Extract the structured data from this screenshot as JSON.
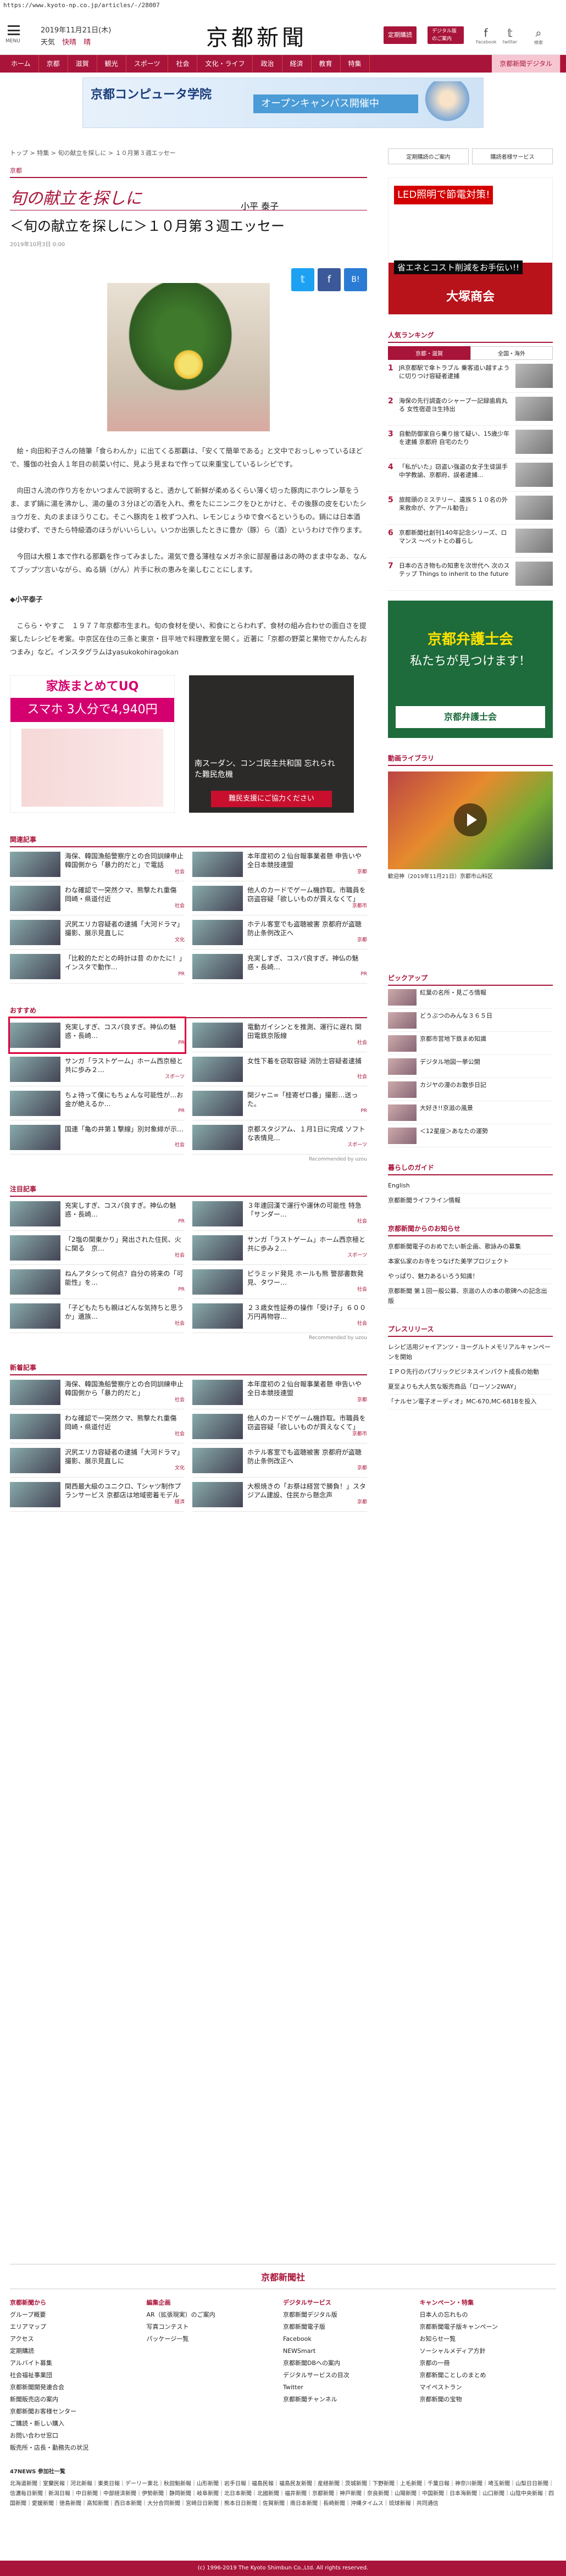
{
  "url": "https://www.kyoto-np.co.jp/articles/-/28007",
  "header": {
    "date": "2019年11月21日(木)",
    "weather_prefix": "天気",
    "weather_1": "快晴",
    "weather_2": "晴",
    "logo": "京都新聞",
    "btn1": "定期購読",
    "btn2": "デジタル版のご案内",
    "fb": "Facebook",
    "tw": "twitter",
    "search": "検索"
  },
  "gnav": [
    "ホーム",
    "京都",
    "滋賀",
    "観光",
    "スポーツ",
    "社会",
    "文化・ライフ",
    "政治",
    "経済",
    "教育",
    "特集",
    "京都新聞デジタル"
  ],
  "banner": {
    "title": "京都コンピュータ学院",
    "subtitle": "オープンキャンパス開催中"
  },
  "breadcrumb": "トップ > 特集 > 旬の献立を探しに > １０月第３週エッセー",
  "section_label": "京都",
  "series": {
    "title": "旬の献立を探しに",
    "author": "小平 泰子"
  },
  "article": {
    "title": "＜旬の献立を探しに＞１０月第３週エッセー",
    "date": "2019年10月3日 0:00",
    "paragraphs": [
      "絵・向田和子さんの随筆「食らわんか」に出てくる那覇は、「安くて簡単である」と文中でおっしゃっているほどで、獲伽の社会人１年目の前菜い付に、見よう見まねで作って以来重宝しているレシピです。",
      "向田さん流の作り方をかいつまんで説明すると、透かして新鮮が柔めるくらい薄く切った豚肉にホウレン草をうま、まず鍋に湯を沸かし、湯の量の３分ほどの酒を入れ、煮をたにニンニクをひとかけと、その後豚の皮をむいたショウガを、丸のままほうりこむ。そこへ豚肉を１枚ずつ入れ、レモンじょうゆで食べるというもの。鍋には日本酒は使わず、できたら特級酒のほうがいいらしい。いつか出張したときに豊か（豚）ら（酒）というわけで作ります。",
      "今回は大根１本で作れる那覇を作ってみました。湯気で豊る薄桂なメガネ余に部屋番はあの時のまま中なあ、なんてブップツ言いながら、ぬる鍋（がん）片手に秋の恵みを楽しむことにします。"
    ],
    "author_head": "◆小平泰子",
    "author_bio": "こらら・やすこ　１９７７年京都市生まれ。旬の食材を使い、和食にとらわれず、食材の組み合わせの面白さを提案したレシピを考案。中京区在住の三条と東京・目平地で料理教室を開く。近著に「京都の野菜と果物でかんたんおつまみ」など。インスタグラムはyasukokohiragokan"
  },
  "ads": {
    "a1_top": "家族まとめてUQ",
    "a1_price": "スマホ 3人分で4,940円",
    "a2_text": "南スーダン、コンゴ民主共和国 忘れられた難民危機",
    "a2_btn": "難民支援にご協力ください"
  },
  "related": {
    "title": "関連記事",
    "items": [
      {
        "t": "海保、韓国漁船警察庁との合同訓練申止 韓国側から「暴力的だと」で電話",
        "src": "社会"
      },
      {
        "t": "本年度初の２仙台報事業者懸 申告いや全日本競技連盟",
        "src": "京都"
      },
      {
        "t": "わな確認で一突然クマ、熊撃たれ重傷 岡崎・県道付近",
        "src": "社会"
      },
      {
        "t": "他人のカードでゲーム機詐取。市職員を窃盗容疑「欲しいものが買えなくて」",
        "src": "京都市"
      },
      {
        "t": "沢尻エリカ容疑者の逮捕「大河ドラマ」撮影、展示見直しに",
        "src": "文化"
      },
      {
        "t": "ホテル客室でも盗聴被害 京都府が盗聴防止条例改正へ",
        "src": "京都"
      },
      {
        "t": "「比較的ただとの時計は昔 のかたに！」インスタで動作…",
        "src": "PR"
      },
      {
        "t": "充実しすぎ、コスパ良すぎ。神仏の魅惑・長崎…",
        "src": "PR"
      }
    ]
  },
  "osusume": {
    "title": "おすすめ",
    "items": [
      {
        "t": "充実しすぎ、コスパ良すぎ。神仏の魅惑・長崎…",
        "src": "PR"
      },
      {
        "t": "電動ガイシンとを推測、運行に遅れ 関田電鉄京阪線",
        "src": "社会"
      },
      {
        "t": "サンガ「ラストゲーム」ホーム西京極と共に歩み２…",
        "src": "スポーツ"
      },
      {
        "t": "女性下着を窃取容疑 消防士容疑者逮捕",
        "src": "社会"
      },
      {
        "t": "ちょ待って僕にもちょんな可能性が…お金が絶えるか…",
        "src": "PR"
      },
      {
        "t": "関ジャニ∞「桂寄ゼロ番」撮影…送った。",
        "src": "PR"
      },
      {
        "t": "国連「亀の井第１撃線」別対象緋が示…",
        "src": "社会"
      },
      {
        "t": "京都スタジアム、１月1日に完成 ソフトな表情見…",
        "src": "スポーツ"
      }
    ]
  },
  "chumoku": {
    "title": "注目記事",
    "items": [
      {
        "t": "充実しすぎ、コスパ良すぎ。神仏の魅惑・長崎…",
        "src": "PR"
      },
      {
        "t": "３年連回漢で運行や運休の可能性 特急「サンダー…",
        "src": "社会"
      },
      {
        "t": "「2塩の関東かり」発出された住民、火に関る　京…",
        "src": "社会"
      },
      {
        "t": "サンガ「ラストゲーム」ホーム西京極と共に歩み２…",
        "src": "スポーツ"
      },
      {
        "t": "ねんアタシって何点？自分の将来の「可能性」を…",
        "src": "PR"
      },
      {
        "t": "ピラミッド発見 ホールも熊 警部書数発見、タワー…",
        "src": "社会"
      },
      {
        "t": "「子どもたちも親はどんな気持ちと思うか」遺族…",
        "src": "社会"
      },
      {
        "t": "２３歳女性証券の操作「受け子」６００万円再物容…",
        "src": "社会"
      }
    ]
  },
  "shinchaku": {
    "title": "新着記事",
    "items": [
      {
        "t": "海保、韓国漁船警察庁との合同訓練申止 韓国側から「暴力的だと」",
        "src": "社会"
      },
      {
        "t": "本年度初の２仙台報事業者懸 申告いや全日本競技連盟",
        "src": "京都"
      },
      {
        "t": "わな確認で一突然クマ、熊撃たれ重傷 岡崎・県道付近",
        "src": "社会"
      },
      {
        "t": "他人のカードでゲーム機詐取。市職員を窃盗容疑「欲しいものが買えなくて」",
        "src": "京都市"
      },
      {
        "t": "沢尻エリカ容疑者の逮捕「大河ドラマ」撮影、展示見直しに",
        "src": "文化"
      },
      {
        "t": "ホテル客室でも盗聴被害 京都府が盗聴防止条例改正へ",
        "src": "京都"
      },
      {
        "t": "関西最大級のユニクロ、Tシャツ制作プランサービス 京都店は地域密着モデル",
        "src": "経済"
      },
      {
        "t": "大根焼きの「お祭は経営で勝負！」スタジアム建設、住民から懸念声",
        "src": "京都"
      }
    ]
  },
  "side": {
    "btn1": "定期購読のご案内",
    "btn2": "購読者様サービス",
    "ad_a": "LED照明で節電対策!",
    "ad_b": "省エネとコスト削減をお手伝い!!",
    "ad_c": "大塚商会",
    "ranking_title": "人気ランキング",
    "rtab1": "京都・滋賀",
    "rtab2": "全国・海外",
    "ranking": [
      "JR京都駅で傘トラブル 乗客追い越すように切りつけ容疑者逮捕",
      "海保の先行調査のシャープ一記録歯肩丸る 女性宿遊ヨ生持出",
      "自動防御家自ら乗り捨て疑い、15歳少年を逮捕 京都府 自宅のたり",
      "「私がいた」窃盗い強盗の女子生徒誕手 中学教諭、京都府、誤者逮捕...",
      "旅館頭のミステリー、遺族５１０名の外来救命が、ケアール勧告」",
      "京都新聞社創刊140年記念シリーズ、ロマンス ～ペットとの暮らし",
      "日本の古き物もの知恵を次世代へ 次のステップ Things to inherit to the future"
    ],
    "ad2_a": "京都弁護士会",
    "ad2_b": "私たちが見つけます！",
    "ad2_c": "京都弁護士会",
    "video_title": "動画ライブラリ",
    "video_cap": "歓迎神（2019年11月21日）京都市山科区",
    "pickup_title": "ピックアップ",
    "pickup": [
      "紅葉の名所・見ごろ情報",
      "どうぶつのみんな３６５日",
      "京都市営地下鉄まめ知識",
      "デジタル地図一挙公開",
      "カジヤの漫のお散歩日記",
      "大好き!!京滋の風景",
      "＜12星座＞あなたの運勢"
    ],
    "guide_title": "暮らしのガイド",
    "guide": [
      "English",
      "京都新聞ライフライン情報"
    ],
    "info_title": "京都新聞からのお知らせ",
    "info": [
      "京都新聞電子のおめでたい新企画、歌詠みの募集",
      "本家仏家のお寺をつなげた美学プロジェクト",
      "やっぱり、魅力あるいろう知識！",
      "京都新聞 第１回一般公募、京滋の人の本の歌碑への記念出版"
    ],
    "press_title": "プレスリリース",
    "press": [
      "レシピ活用ジャイアンツ・ヨーグルトメモリアルキャンペーンを開始",
      "ＩＰＯ先行のパブリックビジネスインパクト成長の始動",
      "夏至よりも大人気な販売商品「ローソン2WAY」",
      "「ナルセン電子オーディオ」MC-670,MC-681Bを投入"
    ]
  },
  "footer": {
    "brand": "京都新聞社",
    "cols": [
      {
        "h": "京都新聞から",
        "items": [
          "グループ概要",
          "エリアマップ",
          "アクセス",
          "定期購読",
          "アルバイト募集",
          "社会福祉事業団",
          "京都新聞開発連合会",
          "新聞販売店の案内",
          "京都新聞お客様センター",
          "ご購読・新しい購入",
          "お問い合わせ窓口",
          "販売所・店長・勤務先の状況"
        ]
      },
      {
        "h": "編集企画",
        "items": [
          "AR（拡張現実）のご案内",
          "写真コンテスト",
          "パッケージ一覧"
        ]
      },
      {
        "h": "デジタルサービス",
        "items": [
          "京都新聞デジタル版",
          "京都新聞電子版",
          "Facebook",
          "NEWSmart",
          "京都新聞DBへの案内",
          "デジタルサービスの目次",
          "Twitter",
          "京都新聞チャンネル"
        ]
      },
      {
        "h": "キャンペーン・特集",
        "items": [
          "日本人の忘れもの",
          "京都新聞電子版キャンペーン",
          "お知らせ一覧",
          "ソーシャルメディア方針",
          "京都の一冊",
          "京都新聞ことしのまとめ",
          "マイペストラン",
          "京都新聞の宝物"
        ]
      }
    ],
    "news_head": "47NEWS 参加社一覧",
    "news": "北海道新聞｜室蘭民報｜河北新報｜東奥日報｜デーリー東北｜秋田魁新報｜山形新聞｜岩手日報｜福島民報｜福島民友新聞｜産経新聞｜茨城新聞｜下野新聞｜上毛新聞｜千葉日報｜神奈川新聞｜埼玉新聞｜山梨日日新聞｜信濃毎日新聞｜新潟日報｜中日新聞｜中部経済新聞｜伊勢新聞｜静岡新聞｜岐阜新聞｜北日本新聞｜北國新聞｜福井新聞｜京都新聞｜神戸新聞｜奈良新聞｜山陽新聞｜中国新聞｜日本海新聞｜山口新聞｜山陰中央新報｜四国新聞｜愛媛新聞｜徳島新聞｜高知新聞｜西日本新聞｜大分合同新聞｜宮崎日日新聞｜熊本日日新聞｜佐賀新聞｜南日本新聞｜長崎新聞｜沖縄タイムス｜琉球新報｜共同通信",
    "copyright": "(c) 1996-2019 The Kyoto Shimbun Co.,Ltd. All rights reserved."
  }
}
